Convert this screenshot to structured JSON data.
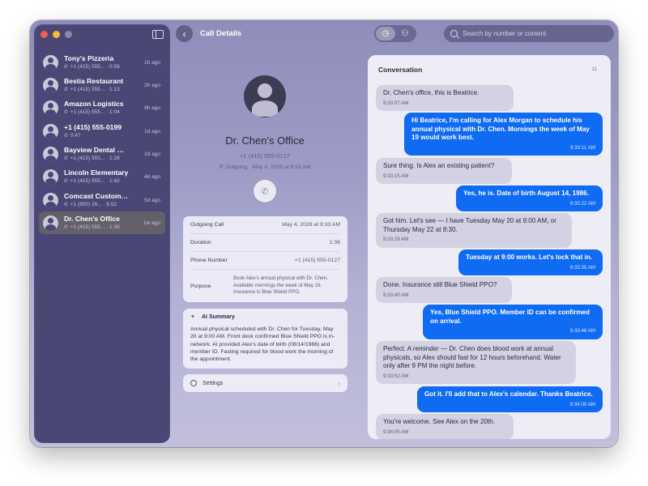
{
  "app": {
    "header_title": "Call Details",
    "search_placeholder": "Search by number or content"
  },
  "sidebar": {
    "calls": [
      {
        "name": "Tony's Pizzeria",
        "sub": "+1 (415) 555... · 0:58",
        "time": "1h ago",
        "selected": false
      },
      {
        "name": "Bestia Restaurant",
        "sub": "+1 (415) 555... · 1:13",
        "time": "2h ago",
        "selected": false
      },
      {
        "name": "Amazon Logistics",
        "sub": "+1 (415) 555... · 1:04",
        "time": "9h ago",
        "selected": false
      },
      {
        "name": "+1 (415) 555-0199",
        "sub": "0:47",
        "time": "1d ago",
        "selected": false
      },
      {
        "name": "Bayview Dental Cli...",
        "sub": "+1 (415) 555... · 1:28",
        "time": "2d ago",
        "selected": false
      },
      {
        "name": "Lincoln Elementary",
        "sub": "+1 (415) 555... · 1:42",
        "time": "4d ago",
        "selected": false
      },
      {
        "name": "Comcast Custome...",
        "sub": "+1 (800) 26... · 6:52",
        "time": "5d ago",
        "selected": false
      },
      {
        "name": "Dr. Chen's Office",
        "sub": "+1 (415) 555... · 1:36",
        "time": "1w ago",
        "selected": true
      }
    ]
  },
  "detail": {
    "name": "Dr. Chen's Office",
    "phone": "+1 (415) 555-0127",
    "meta": "Outgoing · May 4, 2026 at 9:33 AM",
    "info": {
      "rows": [
        {
          "label": "Outgoing Call",
          "value": "May 4, 2026 at 9:33 AM"
        },
        {
          "label": "Duration",
          "value": "1:36"
        },
        {
          "label": "Phone Number",
          "value": "+1 (415) 555-0127"
        },
        {
          "label": "Purpose",
          "value": "Book Alex's annual physical with Dr. Chen. Available mornings the week of May 19. Insurance is Blue Shield PPO."
        }
      ]
    },
    "summary": {
      "title": "AI Summary",
      "body": "Annual physical scheduled with Dr. Chen for Tuesday, May 20 at 9:00 AM. Front desk confirmed Blue Shield PPO is in-network. AI provided Alex's date of birth (08/14/1986) and member ID. Fasting required for blood work the morning of the appointment."
    },
    "settings_label": "Settings"
  },
  "conversation": {
    "title": "Conversation",
    "count": "11",
    "messages": [
      {
        "dir": "in",
        "text": "Dr. Chen's office, this is Beatrice.",
        "time": "9:33:07 AM"
      },
      {
        "dir": "out",
        "text": "Hi Beatrice, I'm calling for Alex Morgan to schedule his annual physical with Dr. Chen. Mornings the week of May 19 would work best.",
        "time": "9:33:11 AM"
      },
      {
        "dir": "in",
        "text": "Sure thing. Is Alex an existing patient?",
        "time": "9:33:15 AM"
      },
      {
        "dir": "out",
        "text": "Yes, he is. Date of birth August 14, 1986.",
        "time": "9:33:22 AM"
      },
      {
        "dir": "in",
        "text": "Got him. Let's see — I have Tuesday May 20 at 9:00 AM, or Thursday May 22 at 8:30.",
        "time": "9:33:29 AM"
      },
      {
        "dir": "out",
        "text": "Tuesday at 9:00 works. Let's lock that in.",
        "time": "9:33:35 AM"
      },
      {
        "dir": "in",
        "text": "Done. Insurance still Blue Shield PPO?",
        "time": "9:33:40 AM"
      },
      {
        "dir": "out",
        "text": "Yes, Blue Shield PPO. Member ID can be confirmed on arrival.",
        "time": "9:33:46 AM"
      },
      {
        "dir": "in",
        "text": "Perfect. A reminder — Dr. Chen does blood work at annual physicals, so Alex should fast for 12 hours beforehand. Water only after 9 PM the night before.",
        "time": "9:33:52 AM"
      },
      {
        "dir": "out",
        "text": "Got it. I'll add that to Alex's calendar. Thanks Beatrice.",
        "time": "9:34:00 AM"
      },
      {
        "dir": "in",
        "text": "You're welcome. See Alex on the 20th.",
        "time": "9:34:05 AM"
      }
    ]
  },
  "colors": {
    "accent_blue": "#0f6bf2",
    "sidebar_bg": "#4a4676",
    "close": "#ee5f57",
    "minimize": "#f6be2f"
  },
  "icons": [
    "close-dot",
    "minimize-dot",
    "sidebar-toggle-icon",
    "back-icon",
    "clock-icon",
    "people-icon",
    "search-icon",
    "person-icon",
    "phone-icon",
    "sparkle-icon",
    "gear-icon",
    "chevron-right-icon"
  ]
}
